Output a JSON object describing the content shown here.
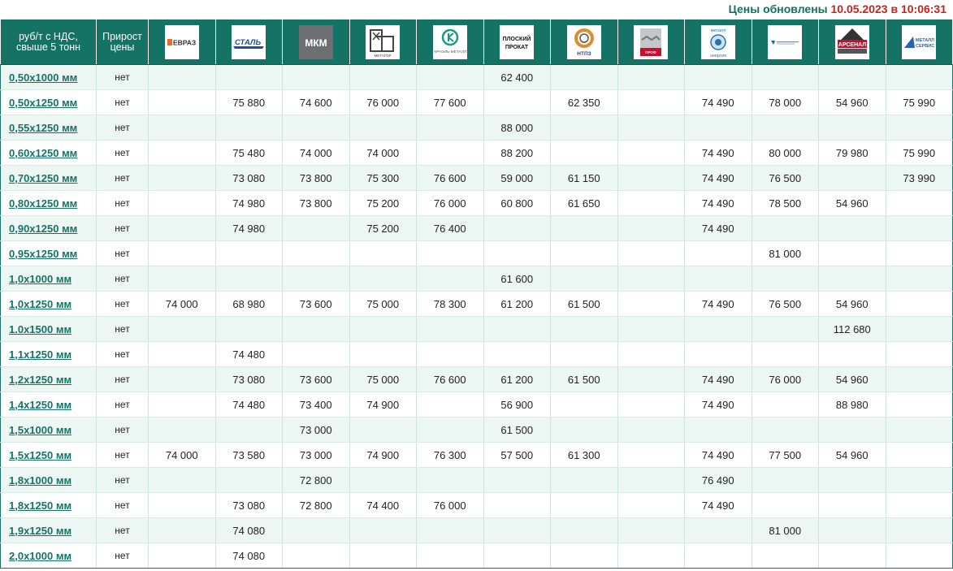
{
  "header": {
    "updated_label": "Цены обновлены",
    "updated_at": "10.05.2023 в 10:06:31"
  },
  "table": {
    "col_size_header": "руб/т с НДС, свыше 5 тонн",
    "col_growth_header": "Прирост цены",
    "suppliers": [
      {
        "name": "evraz",
        "logo_text": "ЕВРАЗ",
        "icon": "evraz-logo"
      },
      {
        "name": "stal",
        "logo_text": "СТАЛЬ",
        "icon": "stal-logo"
      },
      {
        "name": "mkm",
        "logo_text": "МКМ",
        "icon": "mkm-logo"
      },
      {
        "name": "metagor",
        "logo_text": "МЕТАГОР",
        "icon": "metagor-logo"
      },
      {
        "name": "arnel",
        "logo_text": "АРНЭЛЬ МЕТАЛЛ",
        "icon": "arnel-logo"
      },
      {
        "name": "ploskiy-prokat",
        "logo_text": "ПЛОСКИЙ ПРОКАТ",
        "icon": "ploskiy-prokat-logo"
      },
      {
        "name": "ntpz",
        "logo_text": "НТПЗ",
        "icon": "ntpz-logo"
      },
      {
        "name": "prof-metall",
        "logo_text": "ПРОФ МЕТАЛЛ",
        "icon": "prof-metall-logo"
      },
      {
        "name": "metall-energia",
        "logo_text": "МЕТАЛЛ ЭНЕРГИЯ",
        "icon": "metall-energia-logo"
      },
      {
        "name": "sib-company",
        "logo_text": "",
        "icon": "metal-company-logo"
      },
      {
        "name": "arsenal",
        "logo_text": "АРСЕНАЛ",
        "icon": "arsenal-logo"
      },
      {
        "name": "metall-servis",
        "logo_text": "МЕТАЛЛ СЕРВИС",
        "icon": "metall-servis-logo"
      }
    ],
    "rows": [
      {
        "size": "0,50х1000 мм",
        "growth": "нет",
        "prices": [
          "",
          "",
          "",
          "",
          "",
          "62 400",
          "",
          "",
          "",
          "",
          "",
          ""
        ]
      },
      {
        "size": "0,50х1250 мм",
        "growth": "нет",
        "prices": [
          "",
          "75 880",
          "74 600",
          "76 000",
          "77 600",
          "",
          "62 350",
          "",
          "74 490",
          "78 000",
          "54 960",
          "75 990"
        ]
      },
      {
        "size": "0,55х1250 мм",
        "growth": "нет",
        "prices": [
          "",
          "",
          "",
          "",
          "",
          "88 000",
          "",
          "",
          "",
          "",
          "",
          ""
        ]
      },
      {
        "size": "0,60х1250 мм",
        "growth": "нет",
        "prices": [
          "",
          "75 480",
          "74 000",
          "74 000",
          "",
          "88 200",
          "",
          "",
          "74 490",
          "80 000",
          "79 980",
          "75 990"
        ]
      },
      {
        "size": "0,70х1250 мм",
        "growth": "нет",
        "prices": [
          "",
          "73 080",
          "73 800",
          "75 300",
          "76 600",
          "59 000",
          "61 150",
          "",
          "74 490",
          "76 500",
          "",
          "73 990"
        ]
      },
      {
        "size": "0,80х1250 мм",
        "growth": "нет",
        "prices": [
          "",
          "74 980",
          "73 800",
          "75 200",
          "76 000",
          "60 800",
          "61 650",
          "",
          "74 490",
          "78 500",
          "54 960",
          ""
        ]
      },
      {
        "size": "0,90х1250 мм",
        "growth": "нет",
        "prices": [
          "",
          "74 980",
          "",
          "75 200",
          "76 400",
          "",
          "",
          "",
          "74 490",
          "",
          "",
          ""
        ]
      },
      {
        "size": "0,95х1250 мм",
        "growth": "нет",
        "prices": [
          "",
          "",
          "",
          "",
          "",
          "",
          "",
          "",
          "",
          "81 000",
          "",
          ""
        ]
      },
      {
        "size": "1,0х1000 мм",
        "growth": "нет",
        "prices": [
          "",
          "",
          "",
          "",
          "",
          "61 600",
          "",
          "",
          "",
          "",
          "",
          ""
        ]
      },
      {
        "size": "1,0х1250 мм",
        "growth": "нет",
        "prices": [
          "74 000",
          "68 980",
          "73 600",
          "75 000",
          "78 300",
          "61 200",
          "61 500",
          "",
          "74 490",
          "76 500",
          "54 960",
          ""
        ]
      },
      {
        "size": "1.0х1500 мм",
        "growth": "нет",
        "prices": [
          "",
          "",
          "",
          "",
          "",
          "",
          "",
          "",
          "",
          "",
          "112 680",
          ""
        ]
      },
      {
        "size": "1,1х1250 мм",
        "growth": "нет",
        "prices": [
          "",
          "74 480",
          "",
          "",
          "",
          "",
          "",
          "",
          "",
          "",
          "",
          ""
        ]
      },
      {
        "size": "1,2х1250 мм",
        "growth": "нет",
        "prices": [
          "",
          "73 080",
          "73 600",
          "75 000",
          "76 600",
          "61 200",
          "61 500",
          "",
          "74 490",
          "76 000",
          "54 960",
          ""
        ]
      },
      {
        "size": "1,4х1250 мм",
        "growth": "нет",
        "prices": [
          "",
          "74 480",
          "73 400",
          "74 900",
          "",
          "56 900",
          "",
          "",
          "74 490",
          "",
          "88 980",
          ""
        ]
      },
      {
        "size": "1,5х1000 мм",
        "growth": "нет",
        "prices": [
          "",
          "",
          "73 000",
          "",
          "",
          "61 500",
          "",
          "",
          "",
          "",
          "",
          ""
        ]
      },
      {
        "size": "1,5х1250 мм",
        "growth": "нет",
        "prices": [
          "74 000",
          "73 580",
          "73 000",
          "74 900",
          "76 300",
          "57 500",
          "61 300",
          "",
          "74 490",
          "77 500",
          "54 960",
          ""
        ]
      },
      {
        "size": "1,8х1000 мм",
        "growth": "нет",
        "prices": [
          "",
          "",
          "72 800",
          "",
          "",
          "",
          "",
          "",
          "76 490",
          "",
          "",
          ""
        ]
      },
      {
        "size": "1,8х1250 мм",
        "growth": "нет",
        "prices": [
          "",
          "73 080",
          "72 800",
          "74 400",
          "76 000",
          "",
          "",
          "",
          "74 490",
          "",
          "",
          ""
        ]
      },
      {
        "size": "1,9х1250 мм",
        "growth": "нет",
        "prices": [
          "",
          "74 080",
          "",
          "",
          "",
          "",
          "",
          "",
          "",
          "81 000",
          "",
          ""
        ]
      },
      {
        "size": "2,0х1000 мм",
        "growth": "нет",
        "prices": [
          "",
          "74 080",
          "",
          "",
          "",
          "",
          "",
          "",
          "",
          "",
          "",
          ""
        ]
      }
    ]
  }
}
